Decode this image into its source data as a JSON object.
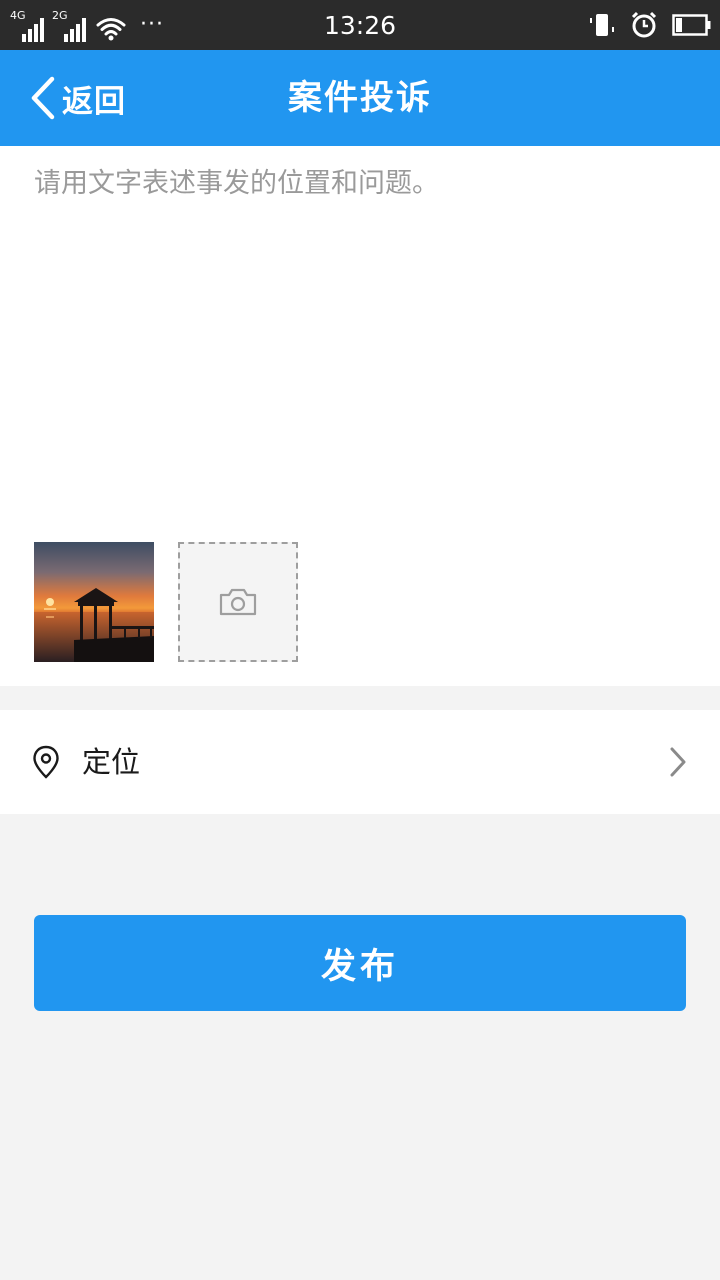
{
  "status_bar": {
    "sim1_label": "4G",
    "sim2_label": "2G",
    "more_label": "···",
    "time": "13:26",
    "icons": [
      "vibrate-icon",
      "alarm-icon",
      "battery-icon"
    ]
  },
  "header": {
    "back_label": "返回",
    "title": "案件投诉"
  },
  "form": {
    "description_placeholder": "请用文字表述事发的位置和问题。",
    "description_value": "",
    "photo_count": 1
  },
  "location": {
    "label": "定位"
  },
  "actions": {
    "publish_label": "发布"
  },
  "colors": {
    "accent": "#2196f0",
    "status_bar": "#2b2b2b",
    "page_background": "#f3f3f3",
    "placeholder": "#9a9a9a"
  }
}
